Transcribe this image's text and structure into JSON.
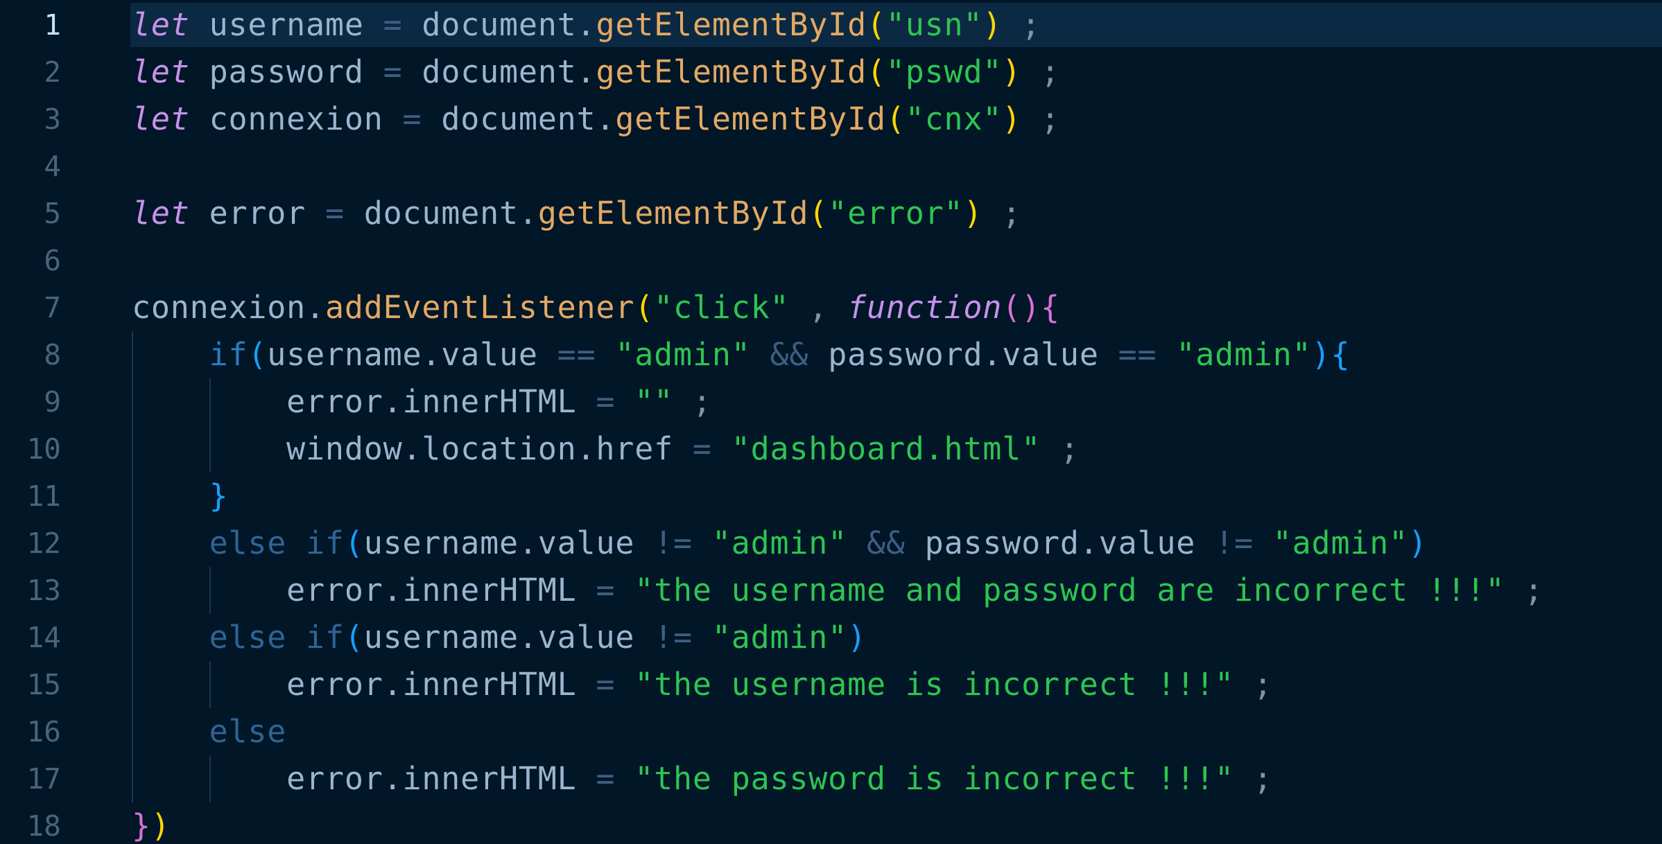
{
  "editor": {
    "language": "javascript",
    "theme": "dark",
    "active_line": 1,
    "line_numbers": [
      "1",
      "2",
      "3",
      "4",
      "5",
      "6",
      "7",
      "8",
      "9",
      "10",
      "11",
      "12",
      "13",
      "14",
      "15",
      "16",
      "17",
      "18"
    ],
    "lines": [
      [
        {
          "t": "let",
          "c": "kw"
        },
        {
          "t": " username ",
          "c": "id"
        },
        {
          "t": "=",
          "c": "op"
        },
        {
          "t": " document.",
          "c": "id"
        },
        {
          "t": "getElementById",
          "c": "fn"
        },
        {
          "t": "(",
          "c": "p1"
        },
        {
          "t": "\"usn\"",
          "c": "str"
        },
        {
          "t": ")",
          "c": "p1"
        },
        {
          "t": " ;",
          "c": "semi"
        }
      ],
      [
        {
          "t": "let",
          "c": "kw"
        },
        {
          "t": " password ",
          "c": "id"
        },
        {
          "t": "=",
          "c": "op"
        },
        {
          "t": " document.",
          "c": "id"
        },
        {
          "t": "getElementById",
          "c": "fn"
        },
        {
          "t": "(",
          "c": "p1"
        },
        {
          "t": "\"pswd\"",
          "c": "str"
        },
        {
          "t": ")",
          "c": "p1"
        },
        {
          "t": " ;",
          "c": "semi"
        }
      ],
      [
        {
          "t": "let",
          "c": "kw"
        },
        {
          "t": " connexion ",
          "c": "id"
        },
        {
          "t": "=",
          "c": "op"
        },
        {
          "t": " document.",
          "c": "id"
        },
        {
          "t": "getElementById",
          "c": "fn"
        },
        {
          "t": "(",
          "c": "p1"
        },
        {
          "t": "\"cnx\"",
          "c": "str"
        },
        {
          "t": ")",
          "c": "p1"
        },
        {
          "t": " ;",
          "c": "semi"
        }
      ],
      [],
      [
        {
          "t": "let",
          "c": "kw"
        },
        {
          "t": " error ",
          "c": "id"
        },
        {
          "t": "=",
          "c": "op"
        },
        {
          "t": " document.",
          "c": "id"
        },
        {
          "t": "getElementById",
          "c": "fn"
        },
        {
          "t": "(",
          "c": "p1"
        },
        {
          "t": "\"error\"",
          "c": "str"
        },
        {
          "t": ")",
          "c": "p1"
        },
        {
          "t": " ;",
          "c": "semi"
        }
      ],
      [],
      [
        {
          "t": "connexion.",
          "c": "id"
        },
        {
          "t": "addEventListener",
          "c": "fn"
        },
        {
          "t": "(",
          "c": "p1"
        },
        {
          "t": "\"click\"",
          "c": "str"
        },
        {
          "t": " , ",
          "c": "semi"
        },
        {
          "t": "function",
          "c": "kwi"
        },
        {
          "t": "(",
          "c": "p2"
        },
        {
          "t": ")",
          "c": "p2"
        },
        {
          "t": "{",
          "c": "p2"
        }
      ],
      [
        {
          "t": "    ",
          "c": "id"
        },
        {
          "t": "if",
          "c": "ctl"
        },
        {
          "t": "(",
          "c": "p3"
        },
        {
          "t": "username.value ",
          "c": "id"
        },
        {
          "t": "==",
          "c": "op"
        },
        {
          "t": " ",
          "c": "id"
        },
        {
          "t": "\"admin\"",
          "c": "str"
        },
        {
          "t": " ",
          "c": "id"
        },
        {
          "t": "&&",
          "c": "op"
        },
        {
          "t": " password.value ",
          "c": "id"
        },
        {
          "t": "==",
          "c": "op"
        },
        {
          "t": " ",
          "c": "id"
        },
        {
          "t": "\"admin\"",
          "c": "str"
        },
        {
          "t": ")",
          "c": "p3"
        },
        {
          "t": "{",
          "c": "p3"
        }
      ],
      [
        {
          "t": "        error.innerHTML ",
          "c": "id"
        },
        {
          "t": "=",
          "c": "op"
        },
        {
          "t": " ",
          "c": "id"
        },
        {
          "t": "\"\"",
          "c": "str"
        },
        {
          "t": " ;",
          "c": "semi"
        }
      ],
      [
        {
          "t": "        window.location.href ",
          "c": "id"
        },
        {
          "t": "=",
          "c": "op"
        },
        {
          "t": " ",
          "c": "id"
        },
        {
          "t": "\"dashboard.html\"",
          "c": "str"
        },
        {
          "t": " ;",
          "c": "semi"
        }
      ],
      [
        {
          "t": "    ",
          "c": "id"
        },
        {
          "t": "}",
          "c": "p3"
        }
      ],
      [
        {
          "t": "    ",
          "c": "id"
        },
        {
          "t": "else if",
          "c": "ctl2"
        },
        {
          "t": "(",
          "c": "p3"
        },
        {
          "t": "username.value ",
          "c": "id"
        },
        {
          "t": "!=",
          "c": "op"
        },
        {
          "t": " ",
          "c": "id"
        },
        {
          "t": "\"admin\"",
          "c": "str"
        },
        {
          "t": " ",
          "c": "id"
        },
        {
          "t": "&&",
          "c": "op"
        },
        {
          "t": " password.value ",
          "c": "id"
        },
        {
          "t": "!=",
          "c": "op"
        },
        {
          "t": " ",
          "c": "id"
        },
        {
          "t": "\"admin\"",
          "c": "str"
        },
        {
          "t": ")",
          "c": "p3"
        }
      ],
      [
        {
          "t": "        error.innerHTML ",
          "c": "id"
        },
        {
          "t": "=",
          "c": "op"
        },
        {
          "t": " ",
          "c": "id"
        },
        {
          "t": "\"the username and password are incorrect !!!\"",
          "c": "str"
        },
        {
          "t": " ;",
          "c": "semi"
        }
      ],
      [
        {
          "t": "    ",
          "c": "id"
        },
        {
          "t": "else if",
          "c": "ctl2"
        },
        {
          "t": "(",
          "c": "p3"
        },
        {
          "t": "username.value ",
          "c": "id"
        },
        {
          "t": "!=",
          "c": "op"
        },
        {
          "t": " ",
          "c": "id"
        },
        {
          "t": "\"admin\"",
          "c": "str"
        },
        {
          "t": ")",
          "c": "p3"
        }
      ],
      [
        {
          "t": "        error.innerHTML ",
          "c": "id"
        },
        {
          "t": "=",
          "c": "op"
        },
        {
          "t": " ",
          "c": "id"
        },
        {
          "t": "\"the username is incorrect !!!\"",
          "c": "str"
        },
        {
          "t": " ;",
          "c": "semi"
        }
      ],
      [
        {
          "t": "    ",
          "c": "id"
        },
        {
          "t": "else",
          "c": "ctl2"
        }
      ],
      [
        {
          "t": "        error.innerHTML ",
          "c": "id"
        },
        {
          "t": "=",
          "c": "op"
        },
        {
          "t": " ",
          "c": "id"
        },
        {
          "t": "\"the password is incorrect !!!\"",
          "c": "str"
        },
        {
          "t": " ;",
          "c": "semi"
        }
      ],
      [
        {
          "t": "}",
          "c": "p2"
        },
        {
          "t": ")",
          "c": "p1"
        }
      ]
    ]
  },
  "colors": {
    "background": "#011627",
    "active_line_highlight": "#0b2942",
    "line_number": "#4b6479",
    "active_line_number": "#c5e4fd",
    "keyword": "#c792ea",
    "string": "#2fc452",
    "function": "#e3a964",
    "identifier": "#9bb5cf"
  }
}
